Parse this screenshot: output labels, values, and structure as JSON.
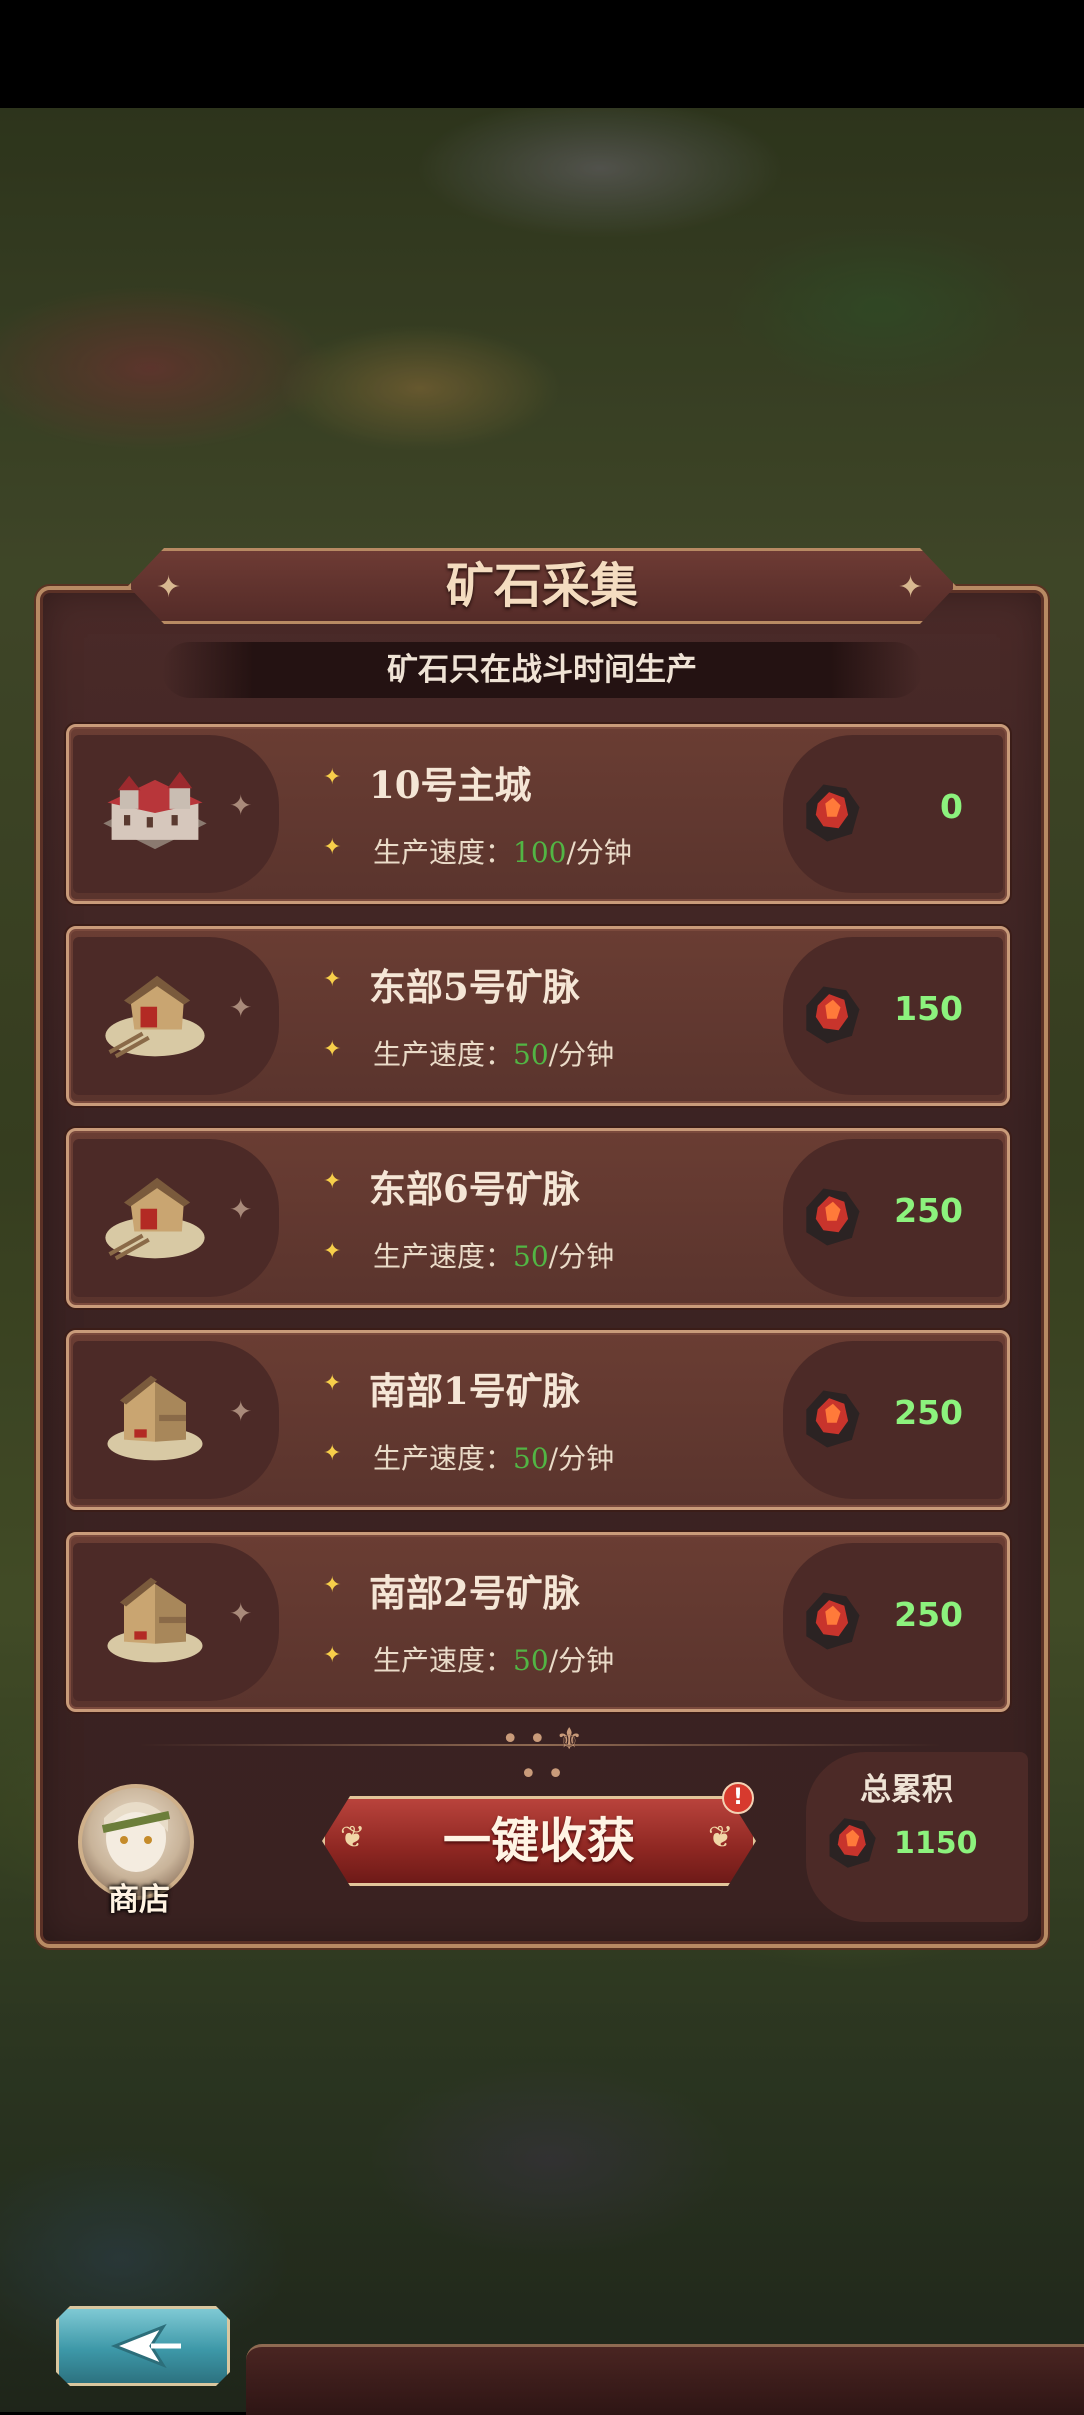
{
  "window": {
    "title": "矿石采集",
    "subtitle": "矿石只在战斗时间生产"
  },
  "mines": [
    {
      "name": "10号主城",
      "rate_label": "生产速度：",
      "rate_value": "100",
      "rate_unit": "/分钟",
      "ore_count": "0",
      "icon": "main-castle-icon"
    },
    {
      "name": "东部5号矿脉",
      "rate_label": "生产速度：",
      "rate_value": "50",
      "rate_unit": "/分钟",
      "ore_count": "150",
      "icon": "mine-hut-icon"
    },
    {
      "name": "东部6号矿脉",
      "rate_label": "生产速度：",
      "rate_value": "50",
      "rate_unit": "/分钟",
      "ore_count": "250",
      "icon": "mine-hut-icon"
    },
    {
      "name": "南部1号矿脉",
      "rate_label": "生产速度：",
      "rate_value": "50",
      "rate_unit": "/分钟",
      "ore_count": "250",
      "icon": "mine-shack-icon"
    },
    {
      "name": "南部2号矿脉",
      "rate_label": "生产速度：",
      "rate_value": "50",
      "rate_unit": "/分钟",
      "ore_count": "250",
      "icon": "mine-shack-icon"
    }
  ],
  "shop": {
    "label": "商店"
  },
  "harvest": {
    "label": "一键收获",
    "badge": "!"
  },
  "total": {
    "label": "总累积",
    "value": "1150"
  },
  "colors": {
    "ore_count": "#8cf27d",
    "rate_value": "#52b544",
    "frame": "#c99b7a"
  }
}
